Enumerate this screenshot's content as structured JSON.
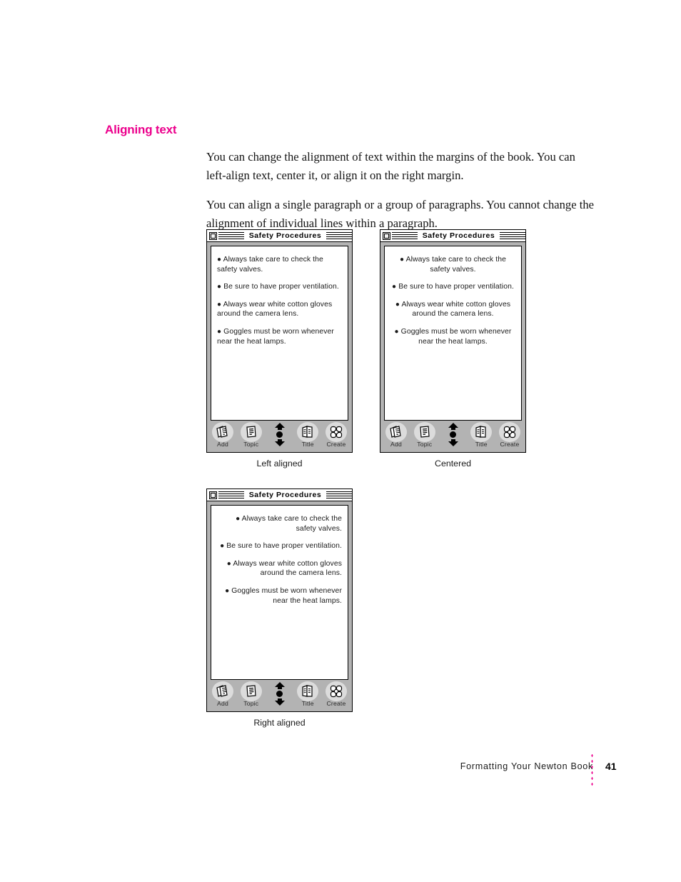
{
  "heading": "Aligning text",
  "heading_color": "#ec008c",
  "body": {
    "paragraphs": [
      "You can change the alignment of text within the margins of the book. You can left-align text, center it, or align it on the right margin.",
      "You can align a single paragraph or a group of paragraphs. You cannot change the alignment of individual lines within a paragraph."
    ]
  },
  "figures": [
    {
      "caption": "Left aligned",
      "alignment": "left",
      "window": {
        "title": "Safety Procedures",
        "close_box": "close-box-icon"
      },
      "bullets": [
        "Always take care to check the safety valves.",
        "Be sure to have proper ventilation.",
        "Always wear white cotton gloves around the camera lens.",
        "Goggles must be worn whenever near the heat lamps."
      ],
      "toolbar": {
        "buttons": [
          {
            "label": "Add",
            "icon": "add-pages-icon"
          },
          {
            "label": "Topic",
            "icon": "topic-page-icon"
          },
          {
            "label": "Title",
            "icon": "title-book-icon"
          },
          {
            "label": "Create",
            "icon": "create-pinwheel-icon"
          }
        ],
        "scroller": {
          "up": "scroll-up-arrow-icon",
          "knob": "scroll-knob-icon",
          "down": "scroll-down-arrow-icon"
        }
      }
    },
    {
      "caption": "Centered",
      "alignment": "center",
      "window": {
        "title": "Safety Procedures",
        "close_box": "close-box-icon"
      },
      "bullets": [
        "Always take care to check the safety valves.",
        "Be sure to have proper ventilation.",
        "Always wear white cotton gloves around the camera lens.",
        "Goggles must be worn whenever near the heat lamps."
      ],
      "toolbar": {
        "buttons": [
          {
            "label": "Add",
            "icon": "add-pages-icon"
          },
          {
            "label": "Topic",
            "icon": "topic-page-icon"
          },
          {
            "label": "Title",
            "icon": "title-book-icon"
          },
          {
            "label": "Create",
            "icon": "create-pinwheel-icon"
          }
        ],
        "scroller": {
          "up": "scroll-up-arrow-icon",
          "knob": "scroll-knob-icon",
          "down": "scroll-down-arrow-icon"
        }
      }
    },
    {
      "caption": "Right aligned",
      "alignment": "right",
      "window": {
        "title": "Safety Procedures",
        "close_box": "close-box-icon"
      },
      "bullets": [
        "Always take care to check the safety valves.",
        "Be sure to have proper ventilation.",
        "Always wear white cotton gloves around the camera lens.",
        "Goggles must be worn whenever near the heat lamps."
      ],
      "toolbar": {
        "buttons": [
          {
            "label": "Add",
            "icon": "add-pages-icon"
          },
          {
            "label": "Topic",
            "icon": "topic-page-icon"
          },
          {
            "label": "Title",
            "icon": "title-book-icon"
          },
          {
            "label": "Create",
            "icon": "create-pinwheel-icon"
          }
        ],
        "scroller": {
          "up": "scroll-up-arrow-icon",
          "knob": "scroll-knob-icon",
          "down": "scroll-down-arrow-icon"
        }
      }
    }
  ],
  "footer": {
    "running_title": "Formatting Your Newton Book",
    "page_number": "41",
    "rule_color": "#ec008c"
  }
}
